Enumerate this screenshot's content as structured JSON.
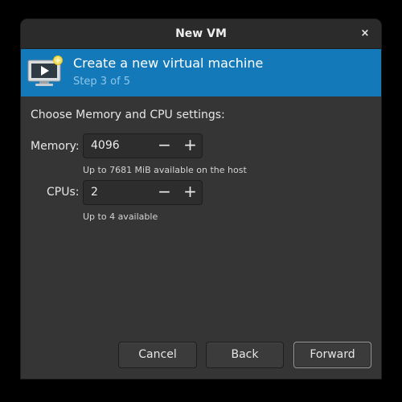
{
  "window": {
    "title": "New VM",
    "close_glyph": "×"
  },
  "banner": {
    "icon": "vm-monitor-icon",
    "title": "Create a new virtual machine",
    "step": "Step 3 of 5",
    "color": "#1479b8"
  },
  "settings": {
    "prompt": "Choose Memory and CPU settings:",
    "memory": {
      "label": "Memory:",
      "value": "4096",
      "hint": "Up to 7681 MiB available on the host"
    },
    "cpus": {
      "label": "CPUs:",
      "value": "2",
      "hint": "Up to 4 available"
    },
    "decrement_glyph": "−",
    "increment_glyph": "+"
  },
  "buttons": {
    "cancel": "Cancel",
    "back": "Back",
    "forward": "Forward"
  }
}
